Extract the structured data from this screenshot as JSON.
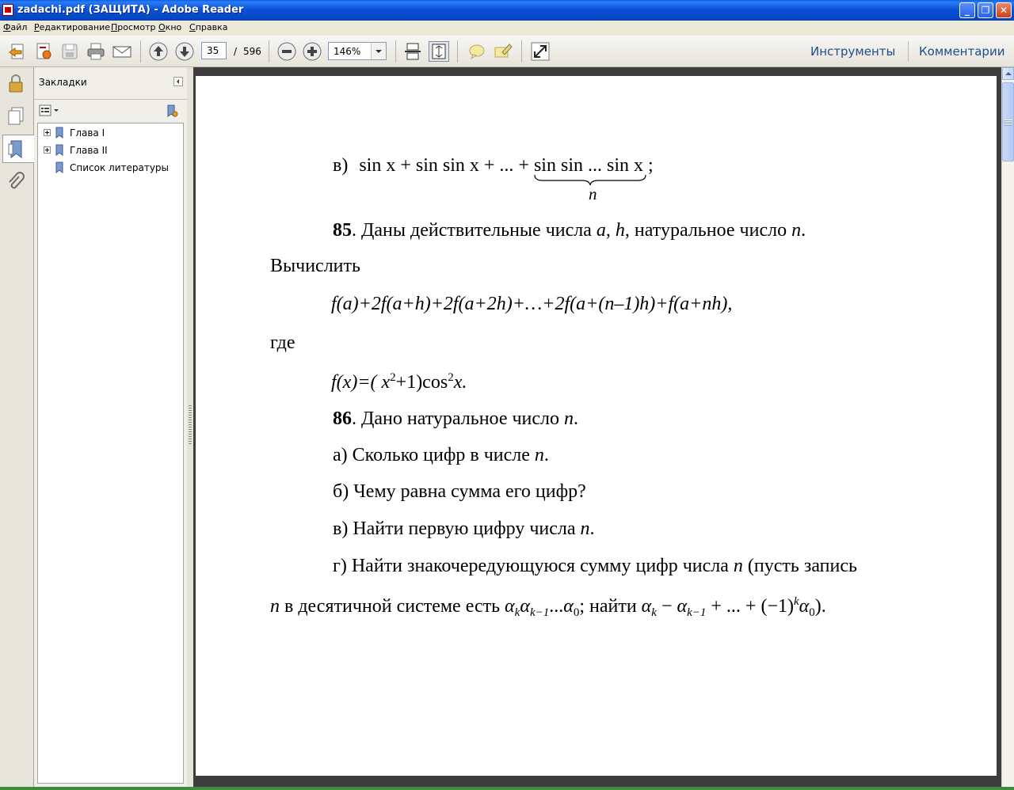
{
  "window": {
    "title": "zadachi.pdf (ЗАЩИТА) - Adobe Reader",
    "minimize": "_",
    "maximize": "❐",
    "close": "✕"
  },
  "menu": [
    "Файл",
    "Редактирование",
    "Просмотр",
    "Окно",
    "Справка"
  ],
  "toolbar": {
    "page_current": "35",
    "page_separator": "/",
    "page_total": "596",
    "zoom": "146%",
    "tools_link": "Инструменты",
    "comments_link": "Комментарии"
  },
  "bookmarks": {
    "title": "Закладки",
    "items": [
      {
        "label": "Глава I",
        "expandable": true
      },
      {
        "label": "Глава II",
        "expandable": true
      },
      {
        "label": "Список литературы",
        "expandable": false
      }
    ]
  },
  "document": {
    "l1_prefix": "в)",
    "l1_main": "sin x + sin sin x + ... +",
    "l1_brace": "sin sin ... sin x",
    "l1_suffix": ";",
    "l1_under": "n",
    "p85_num": "85",
    "p85_a": ". Даны действительные числа ",
    "p85_vars": "a, h",
    "p85_b": ", натуральное число ",
    "p85_n": "n",
    "p85_end": ".",
    "compute": "Вычислить",
    "formula": "f(a)+2f(a+h)+2f(a+2h)+…+2f(a+(n–1)h)+f(a+nh),",
    "where": "где",
    "fx_left": "f(x)=( x",
    "fx_sq": "2",
    "fx_mid": "+1)cos",
    "fx_sq2": "2",
    "fx_right": "x.",
    "p86_num": "86",
    "p86_text": ". Дано натуральное число ",
    "p86_n": "n",
    "p86_end": ".",
    "qa": "а) Сколько цифр в числе ",
    "qa_n": "n",
    "qa_end": ".",
    "qb": "б) Чему равна сумма его цифр?",
    "qv": "в) Найти первую цифру числа ",
    "qv_n": "n",
    "qv_end": ".",
    "qg": "г) Найти знакочередующуюся сумму цифр числа ",
    "qg_n": "n",
    "qg_rest": " (пусть запись",
    "last_n": "n",
    "last_text": " в десятичной системе есть ",
    "alpha": "α",
    "k": "k",
    "k1": "k−1",
    "dots": "...",
    "zero": "0",
    "find": "; найти ",
    "minus": " − ",
    "plus_dots": " + ... + ",
    "neg1": "(−1)",
    "close_paren": ")."
  }
}
